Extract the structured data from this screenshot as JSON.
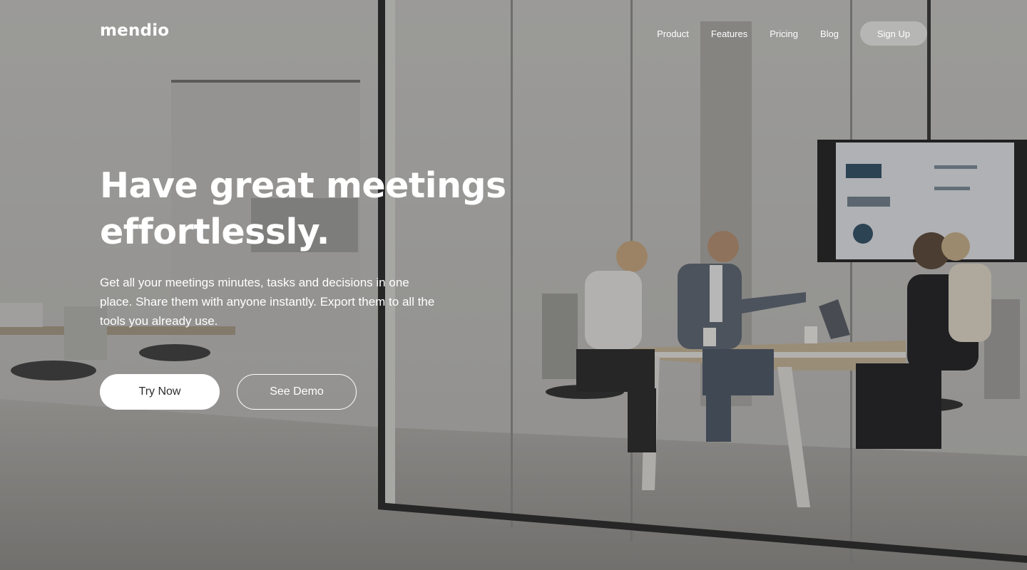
{
  "brand": {
    "logo_text": "mendio"
  },
  "nav": {
    "links": [
      "Product",
      "Features",
      "Pricing",
      "Blog"
    ],
    "signup_label": "Sign Up"
  },
  "hero": {
    "headline_line1": "Have great meetings",
    "headline_line2": "effortlessly.",
    "subtext": "Get all your meetings minutes, tasks and decisions in one place. Share them with anyone instantly. Export them to all the tools you already use.",
    "primary_cta": "Try Now",
    "secondary_cta": "See Demo"
  },
  "colors": {
    "text": "#ffffff",
    "overlay": "#282828",
    "primary_button_bg": "#ffffff",
    "primary_button_text": "#2d2d2d"
  }
}
